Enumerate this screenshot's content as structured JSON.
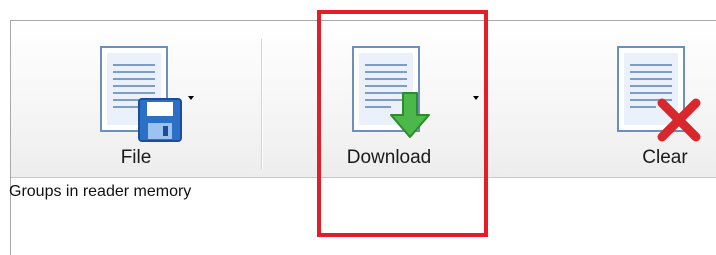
{
  "ribbon": {
    "buttons": [
      {
        "label": "File",
        "icon": "document-save-icon",
        "has_dropdown": true
      },
      {
        "label": "Download",
        "icon": "document-download-icon",
        "has_dropdown": true
      },
      {
        "label": "Clear",
        "icon": "document-clear-icon",
        "has_dropdown": false
      }
    ]
  },
  "content": {
    "group_label": "Groups in reader memory"
  },
  "colors": {
    "highlight": "#e41e26",
    "download_arrow": "#4db84a",
    "clear_x": "#d9272e",
    "save_disk": "#2c6fc7"
  }
}
